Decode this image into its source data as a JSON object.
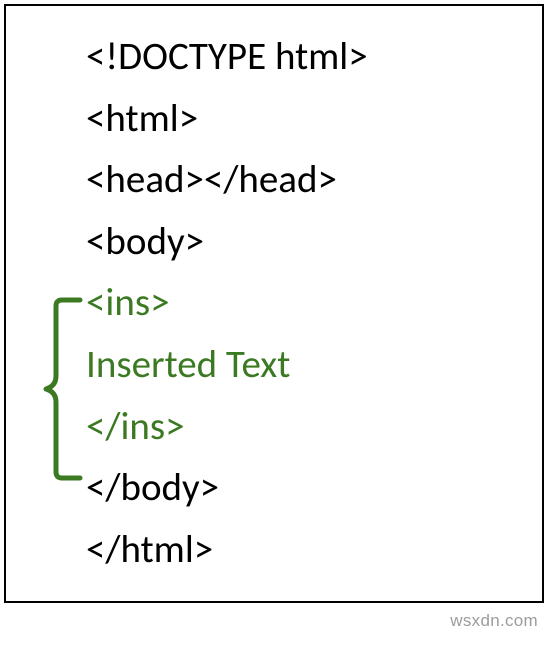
{
  "code": {
    "line1": "<!DOCTYPE html>",
    "line2": "<html>",
    "line3": "<head></head>",
    "line4": "<body>",
    "line5": "<ins>",
    "line6": "Inserted Text",
    "line7": "</ins>",
    "line8": "</body>",
    "line9": "</html>"
  },
  "colors": {
    "default": "#000000",
    "highlight": "#3b7a23",
    "bracket": "#3b7a23"
  },
  "watermark": "wsxdn.com"
}
